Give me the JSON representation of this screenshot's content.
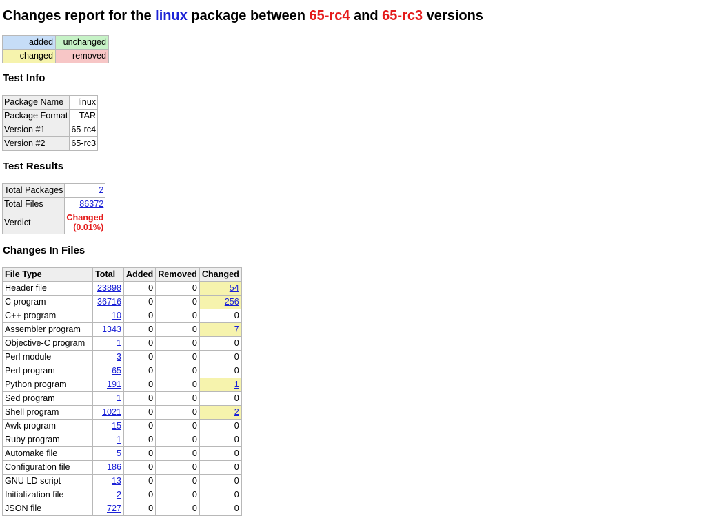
{
  "title": {
    "prefix": "Changes report for the ",
    "package": "linux",
    "mid": " package between ",
    "version1": "65-rc4",
    "and": " and ",
    "version2": "65-rc3",
    "suffix": " versions"
  },
  "legend": {
    "added": "added",
    "unchanged": "unchanged",
    "changed": "changed",
    "removed": "removed",
    "colors": {
      "added": "#c6ddf7",
      "unchanged": "#c6f2c6",
      "changed": "#f6f3ad",
      "removed": "#f7c6c6"
    }
  },
  "test_info": {
    "heading": "Test Info",
    "rows": [
      {
        "key": "Package Name",
        "value": "linux"
      },
      {
        "key": "Package Format",
        "value": "TAR"
      },
      {
        "key": "Version #1",
        "value": "65-rc4"
      },
      {
        "key": "Version #2",
        "value": "65-rc3"
      }
    ]
  },
  "test_results": {
    "heading": "Test Results",
    "total_packages_label": "Total Packages",
    "total_packages": "2",
    "total_files_label": "Total Files",
    "total_files": "86372",
    "verdict_label": "Verdict",
    "verdict_line1": "Changed",
    "verdict_line2": "(0.01%)"
  },
  "changes_in_files": {
    "heading": "Changes In Files",
    "columns": [
      "File Type",
      "Total",
      "Added",
      "Removed",
      "Changed"
    ],
    "rows": [
      {
        "type": "Header file",
        "total": "23898",
        "added": "0",
        "removed": "0",
        "changed": "54"
      },
      {
        "type": "C program",
        "total": "36716",
        "added": "0",
        "removed": "0",
        "changed": "256"
      },
      {
        "type": "C++ program",
        "total": "10",
        "added": "0",
        "removed": "0",
        "changed": "0"
      },
      {
        "type": "Assembler program",
        "total": "1343",
        "added": "0",
        "removed": "0",
        "changed": "7"
      },
      {
        "type": "Objective-C program",
        "total": "1",
        "added": "0",
        "removed": "0",
        "changed": "0"
      },
      {
        "type": "Perl module",
        "total": "3",
        "added": "0",
        "removed": "0",
        "changed": "0"
      },
      {
        "type": "Perl program",
        "total": "65",
        "added": "0",
        "removed": "0",
        "changed": "0"
      },
      {
        "type": "Python program",
        "total": "191",
        "added": "0",
        "removed": "0",
        "changed": "1"
      },
      {
        "type": "Sed program",
        "total": "1",
        "added": "0",
        "removed": "0",
        "changed": "0"
      },
      {
        "type": "Shell program",
        "total": "1021",
        "added": "0",
        "removed": "0",
        "changed": "2"
      },
      {
        "type": "Awk program",
        "total": "15",
        "added": "0",
        "removed": "0",
        "changed": "0"
      },
      {
        "type": "Ruby program",
        "total": "1",
        "added": "0",
        "removed": "0",
        "changed": "0"
      },
      {
        "type": "Automake file",
        "total": "5",
        "added": "0",
        "removed": "0",
        "changed": "0"
      },
      {
        "type": "Configuration file",
        "total": "186",
        "added": "0",
        "removed": "0",
        "changed": "0"
      },
      {
        "type": "GNU LD script",
        "total": "13",
        "added": "0",
        "removed": "0",
        "changed": "0"
      },
      {
        "type": "Initialization file",
        "total": "2",
        "added": "0",
        "removed": "0",
        "changed": "0"
      },
      {
        "type": "JSON file",
        "total": "727",
        "added": "0",
        "removed": "0",
        "changed": "0"
      }
    ]
  }
}
